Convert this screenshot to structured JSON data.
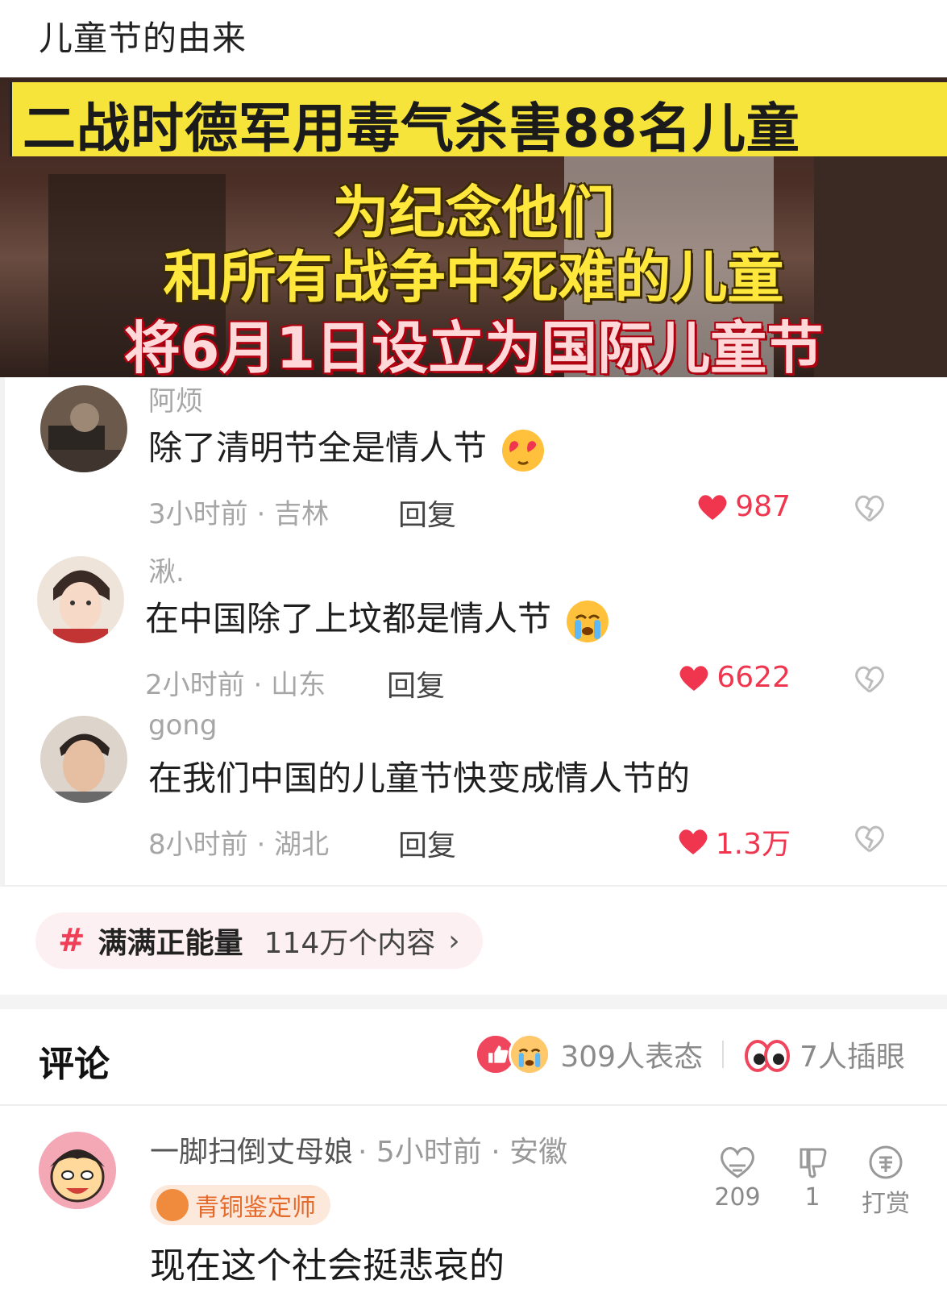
{
  "post": {
    "title": "儿童节的由来"
  },
  "banner": {
    "headline": "二战时德军用毒气杀害88名儿童",
    "line1": "为纪念他们",
    "line2": "和所有战争中死难的儿童",
    "line3": "将6月1日设立为国际儿童节"
  },
  "inner_comments": [
    {
      "name": "阿烦",
      "text": "除了清明节全是情人节",
      "emoji": "heart-eyes-emoji",
      "time": "3小时前",
      "location": "吉林",
      "reply": "回复",
      "likes": "987"
    },
    {
      "name": "湫.",
      "text": "在中国除了上坟都是情人节",
      "emoji": "crying-emoji",
      "time": "2小时前",
      "location": "山东",
      "reply": "回复",
      "likes": "6622"
    },
    {
      "name": "gong",
      "text": "在我们中国的儿童节快变成情人节的",
      "emoji": "",
      "time": "8小时前",
      "location": "湖北",
      "reply": "回复",
      "likes": "1.3万"
    }
  ],
  "topic": {
    "hash": "#",
    "name": "满满正能量",
    "count": "114万个内容",
    "chevron": "›"
  },
  "comments": {
    "header": "评论",
    "reactions_text": "309人表态",
    "eyes_text": "7人插眼"
  },
  "main_comment": {
    "username": "一脚扫倒丈母娘",
    "meta": "· 5小时前 · 安徽",
    "badge": "青铜鉴定师",
    "body": "现在这个社会挺悲哀的",
    "likes": "209",
    "dislikes": "1",
    "reward": "打赏"
  },
  "colors": {
    "accent": "#f0354f",
    "banner_yellow": "#f7e43a",
    "meta_gray": "#a6a6a6"
  }
}
